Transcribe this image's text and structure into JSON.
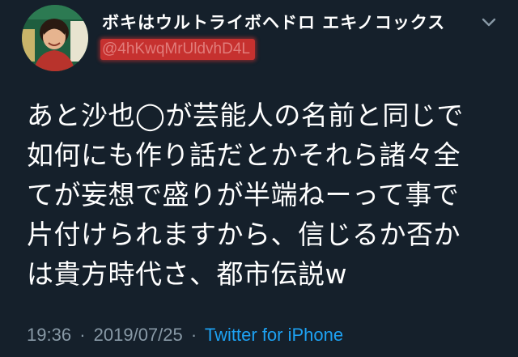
{
  "tweet": {
    "display_name": "ボキはウルトライボヘドロ エキノコックス",
    "handle": "@4hKwqMrUldvhD4L",
    "text": "あと沙也◯が芸能人の名前と同じで\n如何にも作り話だとかそれら諸々全\nてが妄想で盛りが半端ねーって事で\n片付けられますから、信じるか否か\nは貴方時代さ、都市伝説w",
    "time": "19:36",
    "separator": "·",
    "date": "2019/07/25",
    "source": "Twitter for iPhone"
  },
  "colors": {
    "background": "#15202b",
    "handle_highlight": "#c6312f",
    "link": "#1da1f2",
    "meta": "#8899a6"
  },
  "icons": {
    "avatar": "profile-photo",
    "menu": "chevron-down-icon"
  }
}
